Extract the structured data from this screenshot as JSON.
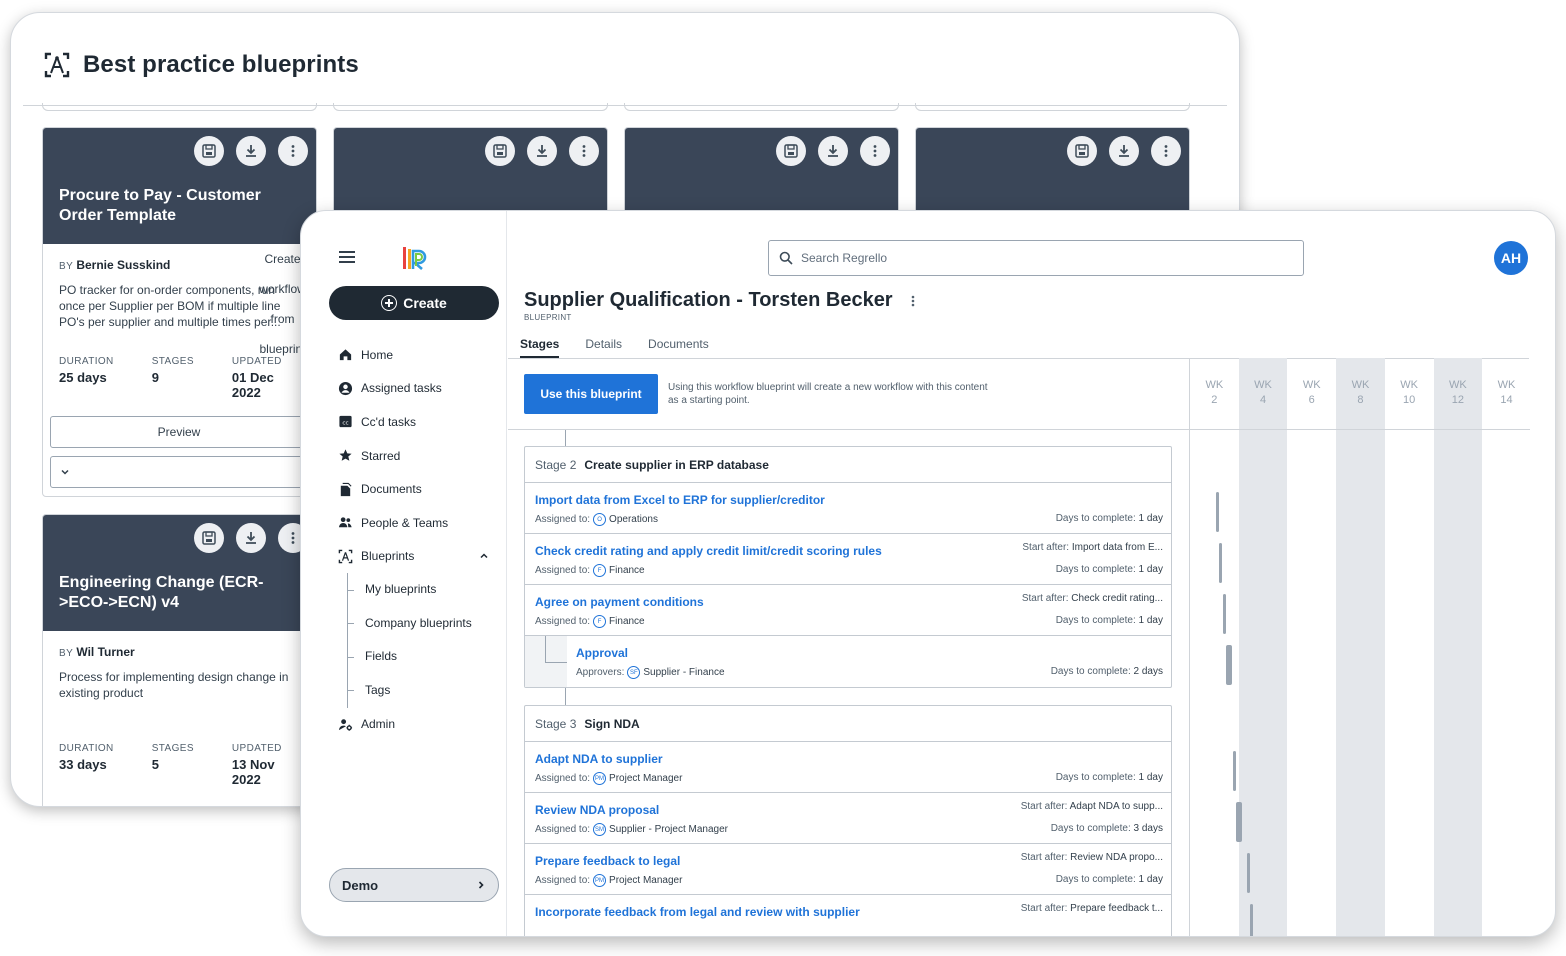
{
  "back_window": {
    "title": "Best practice blueprints",
    "cards": [
      {
        "title": "Procure to Pay - Customer Order Template",
        "by_label": "BY",
        "author": "Bernie Susskind",
        "description": "PO tracker for on-order components, run once per Supplier per BOM if multiple line PO's per supplier and multiple times per...",
        "duration_label": "DURATION",
        "duration": "25 days",
        "stages_label": "STAGES",
        "stages": "9",
        "updated_label": "UPDATED",
        "updated": "01 Dec 2022",
        "preview_label": "Preview",
        "create_label": "Create workflow from blueprint"
      },
      {
        "title": "Engineering Change (ECR->ECO->ECN) v4",
        "by_label": "BY",
        "author": "Wil Turner",
        "description": "Process for implementing design change in existing product",
        "duration_label": "DURATION",
        "duration": "33 days",
        "stages_label": "STAGES",
        "stages": "5",
        "updated_label": "UPDATED",
        "updated": "13 Nov 2022"
      }
    ]
  },
  "sidebar": {
    "create_label": "Create",
    "nav": [
      {
        "label": "Home",
        "icon": "home-icon"
      },
      {
        "label": "Assigned tasks",
        "icon": "user-circle-icon"
      },
      {
        "label": "Cc'd tasks",
        "icon": "cc-icon"
      },
      {
        "label": "Starred",
        "icon": "star-icon"
      },
      {
        "label": "Documents",
        "icon": "documents-icon"
      },
      {
        "label": "People & Teams",
        "icon": "people-icon"
      },
      {
        "label": "Blueprints",
        "icon": "blueprint-icon"
      }
    ],
    "blueprint_sub": [
      "My blueprints",
      "Company blueprints",
      "Fields",
      "Tags"
    ],
    "admin_label": "Admin",
    "demo_label": "Demo"
  },
  "header": {
    "search_placeholder": "Search Regrello",
    "avatar_initials": "AH",
    "title": "Supplier Qualification - Torsten Becker",
    "subtitle": "BLUEPRINT",
    "tabs": [
      "Stages",
      "Details",
      "Documents"
    ]
  },
  "use_blueprint": {
    "button_label": "Use this blueprint",
    "note": "Using this workflow blueprint will create a new workflow with this content as a starting point."
  },
  "labels": {
    "assigned_to": "Assigned to:",
    "approvers": "Approvers:",
    "days_to_complete": "Days to complete:",
    "start_after": "Start after:"
  },
  "stages": [
    {
      "num": "Stage 2",
      "name": "Create supplier in ERP database",
      "tasks": [
        {
          "name": "Import data from Excel to ERP for supplier/creditor",
          "badge": "O",
          "assignee": "Operations",
          "start_after": "",
          "days": "1 day"
        },
        {
          "name": "Check credit rating and apply credit limit/credit scoring rules",
          "badge": "F",
          "assignee": "Finance",
          "start_after": "Import data from E...",
          "days": "1 day"
        },
        {
          "name": "Agree on payment conditions",
          "badge": "F",
          "assignee": "Finance",
          "start_after": "Check credit rating...",
          "days": "1 day"
        },
        {
          "name": "Approval",
          "badge": "SF",
          "assignee": "Supplier - Finance",
          "start_after": "",
          "days": "2 days",
          "approval": true
        }
      ]
    },
    {
      "num": "Stage 3",
      "name": "Sign NDA",
      "tasks": [
        {
          "name": "Adapt NDA to supplier",
          "badge": "PM",
          "assignee": "Project Manager",
          "start_after": "",
          "days": "1 day"
        },
        {
          "name": "Review NDA proposal",
          "badge": "SM",
          "assignee": "Supplier - Project Manager",
          "start_after": "Adapt NDA to supp...",
          "days": "3 days"
        },
        {
          "name": "Prepare feedback to legal",
          "badge": "PM",
          "assignee": "Project Manager",
          "start_after": "Review NDA propo...",
          "days": "1 day"
        },
        {
          "name": "Incorporate feedback from legal and review with supplier",
          "badge": "",
          "assignee": "",
          "start_after": "Prepare feedback t...",
          "days": ""
        }
      ]
    }
  ],
  "gantt": {
    "weeks": [
      {
        "wk": "WK",
        "n": "2"
      },
      {
        "wk": "WK",
        "n": "4"
      },
      {
        "wk": "WK",
        "n": "6"
      },
      {
        "wk": "WK",
        "n": "8"
      },
      {
        "wk": "WK",
        "n": "10"
      },
      {
        "wk": "WK",
        "n": "12"
      },
      {
        "wk": "WK",
        "n": "14"
      }
    ],
    "shaded_weeks": [
      1,
      3,
      5
    ],
    "task_spans_days": [
      1,
      1,
      1,
      2,
      1,
      3,
      1,
      1
    ]
  },
  "colors": {
    "card_header": "#3a4658",
    "accent": "#1f73d8",
    "create_button": "#1f2933"
  }
}
